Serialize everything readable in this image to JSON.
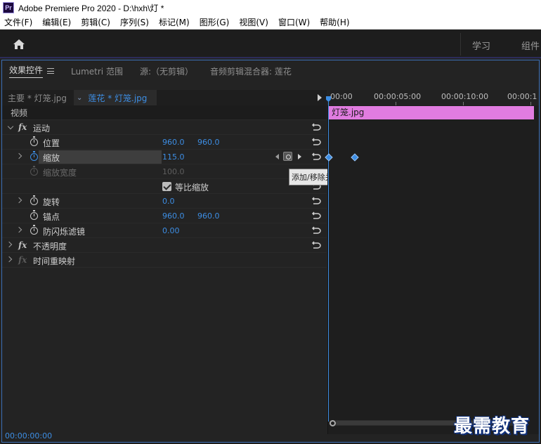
{
  "window": {
    "app_icon": "Pr",
    "title": "Adobe Premiere Pro 2020 - D:\\hxh\\灯 *"
  },
  "menu": [
    "文件(F)",
    "编辑(E)",
    "剪辑(C)",
    "序列(S)",
    "标记(M)",
    "图形(G)",
    "视图(V)",
    "窗口(W)",
    "帮助(H)"
  ],
  "workspace": {
    "tabs": [
      "学习",
      "组件"
    ]
  },
  "panel_tabs": [
    {
      "label": "效果控件",
      "active": true
    },
    {
      "label": "Lumetri 范围"
    },
    {
      "label": "源:（无剪辑）"
    },
    {
      "label": "音频剪辑混合器: 莲花"
    }
  ],
  "source": {
    "master": "主要 * 灯笼.jpg",
    "clip": "莲花 * 灯笼.jpg"
  },
  "effects": {
    "section_video": "视频",
    "motion": "运动",
    "position": {
      "label": "位置",
      "x": "960.0",
      "y": "960.0"
    },
    "scale": {
      "label": "缩放",
      "value": "115.0"
    },
    "scale_width": {
      "label": "缩放宽度",
      "value": "100.0"
    },
    "uniform_scale": {
      "label": "等比缩放",
      "checked": true
    },
    "rotation": {
      "label": "旋转",
      "value": "0.0"
    },
    "anchor": {
      "label": "锚点",
      "x": "960.0",
      "y": "960.0"
    },
    "anti_flicker": {
      "label": "防闪烁滤镜",
      "value": "0.00"
    },
    "opacity": "不透明度",
    "time_remap": "时间重映射",
    "fx_glyph": "fx"
  },
  "tooltip": "添加/移除关键帧",
  "timeline": {
    "ruler": [
      "00:00",
      "00:00:05:00",
      "00:00:10:00",
      "00:00:1"
    ],
    "clip_label": "灯笼.jpg",
    "clip_color": "#e17ce0"
  },
  "footer": {
    "timecode": "00:00:00:00"
  },
  "watermark": "最需教育",
  "colors": {
    "accent": "#3d8ee4",
    "panel_bg": "#232323"
  }
}
